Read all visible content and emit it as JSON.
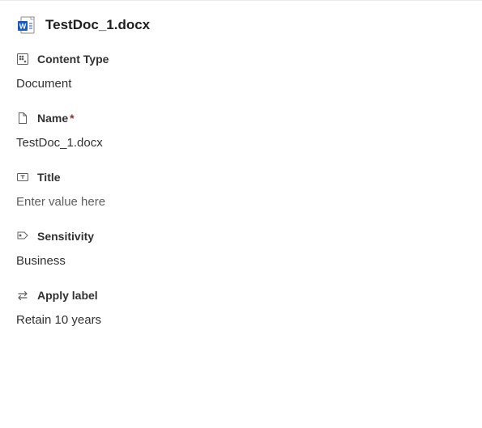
{
  "header": {
    "filename": "TestDoc_1.docx"
  },
  "fields": {
    "contentType": {
      "label": "Content Type",
      "value": "Document"
    },
    "name": {
      "label": "Name",
      "required_mark": "*",
      "value": "TestDoc_1.docx"
    },
    "title": {
      "label": "Title",
      "placeholder": "Enter value here"
    },
    "sensitivity": {
      "label": "Sensitivity",
      "value": "Business"
    },
    "applyLabel": {
      "label": "Apply label",
      "value": "Retain 10 years"
    }
  }
}
